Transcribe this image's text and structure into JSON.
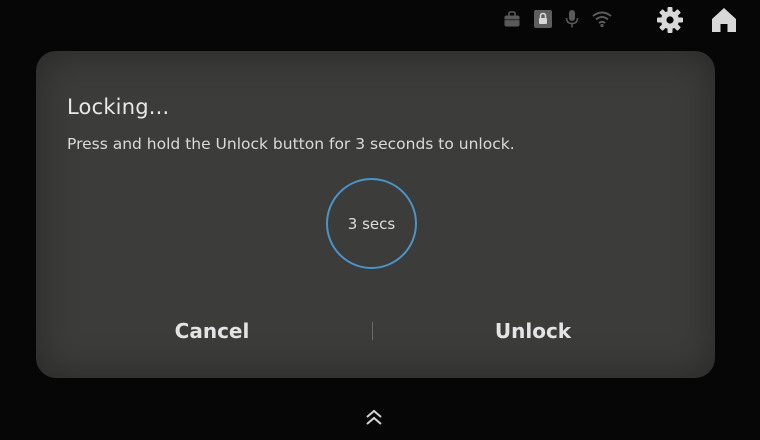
{
  "status_bar": {
    "icons": [
      "bag-icon",
      "lock-icon",
      "microphone-icon",
      "wifi-icon",
      "gear-icon",
      "home-icon"
    ]
  },
  "dialog": {
    "title": "Locking...",
    "message": "Press and hold the Unlock button for 3 seconds to unlock.",
    "countdown_label": "3 secs",
    "cancel_label": "Cancel",
    "unlock_label": "Unlock"
  },
  "bottom": {
    "icon": "double-chevron-up-icon"
  },
  "colors": {
    "background": "#060606",
    "dialog_background": "#3c3c3a",
    "countdown_ring": "#4a94c8",
    "text": "#e6e6e6",
    "status_icon_dim": "#5a5a5a",
    "status_icon_bright": "#d8d8d8"
  }
}
